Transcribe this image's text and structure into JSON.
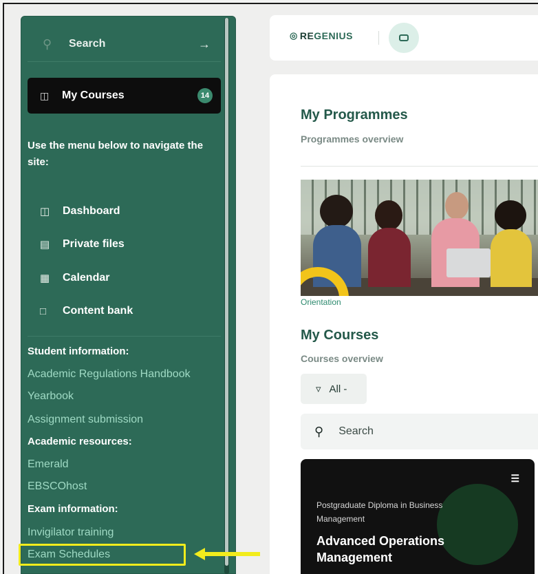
{
  "sidebar": {
    "search_label": "Search",
    "my_courses": {
      "label": "My Courses",
      "count": "14"
    },
    "intro_text": "Use the menu below to navigate the site:",
    "nav_items": [
      {
        "label": "Dashboard",
        "icon": "dashboard-icon"
      },
      {
        "label": "Private files",
        "icon": "inbox-icon"
      },
      {
        "label": "Calendar",
        "icon": "calendar-icon"
      },
      {
        "label": "Content bank",
        "icon": "folder-icon"
      }
    ],
    "student_info_heading": "Student information:",
    "student_links": [
      "Academic Regulations Handbook",
      "Yearbook",
      "Assignment submission"
    ],
    "academic_heading": "Academic resources:",
    "academic_links": [
      "Emerald",
      "EBSCOhost"
    ],
    "exam_heading": "Exam information:",
    "exam_links": [
      "Invigilator training",
      "Exam Schedules"
    ]
  },
  "header": {
    "logo_prefix": "RE",
    "logo_suffix": "GENIUS"
  },
  "main": {
    "programmes_title": "My Programmes",
    "programmes_subtitle": "Programmes overview",
    "banner_caption": "Orientation",
    "courses_title": "My Courses",
    "courses_subtitle": "Courses overview",
    "filter_label": "All -",
    "search_placeholder": "Search",
    "course_card": {
      "programme": "Postgraduate Diploma in Business Management",
      "title": "Advanced Operations Management"
    }
  },
  "colors": {
    "sidebar": "#2d6a57",
    "link": "#9fdac4",
    "highlight": "#f2ec1c",
    "card": "#111111"
  }
}
